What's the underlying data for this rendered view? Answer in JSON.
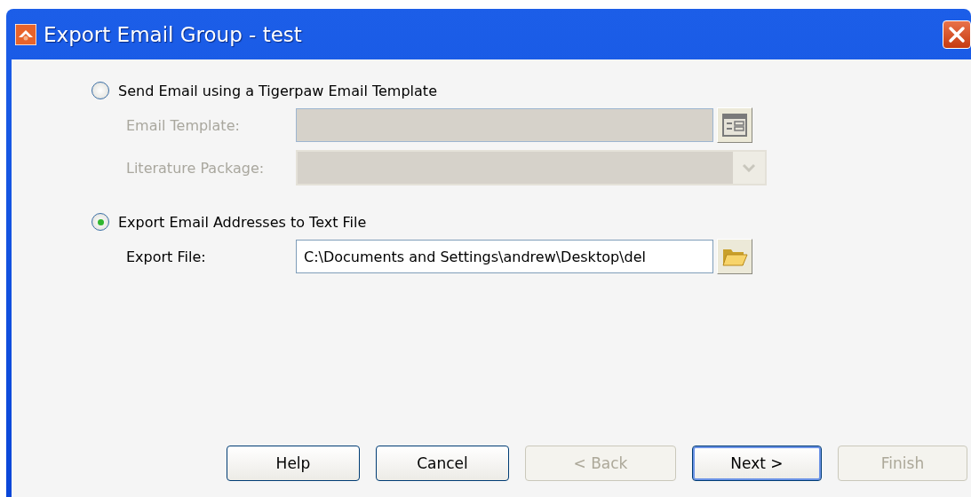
{
  "window": {
    "title": "Export Email Group - test"
  },
  "options": [
    {
      "label": "Send Email using a Tigerpaw Email Template",
      "selected": false,
      "fields": [
        {
          "kind": "picker",
          "label": "Email Template:",
          "disabled": true
        },
        {
          "kind": "dropdown",
          "label": "Literature Package:",
          "disabled": true
        }
      ]
    },
    {
      "label": "Export Email Addresses to Text File",
      "selected": true,
      "fields": [
        {
          "kind": "file",
          "label": "Export File:",
          "value": "C:\\Documents and Settings\\andrew\\Desktop\\del",
          "disabled": false
        }
      ]
    }
  ],
  "buttons": [
    {
      "label": "Help",
      "disabled": false,
      "default": false
    },
    {
      "label": "Cancel",
      "disabled": false,
      "default": false
    },
    {
      "label": "< Back",
      "disabled": true,
      "default": false
    },
    {
      "label": "Next >",
      "disabled": false,
      "default": true
    },
    {
      "label": "Finish",
      "disabled": true,
      "default": false
    }
  ]
}
